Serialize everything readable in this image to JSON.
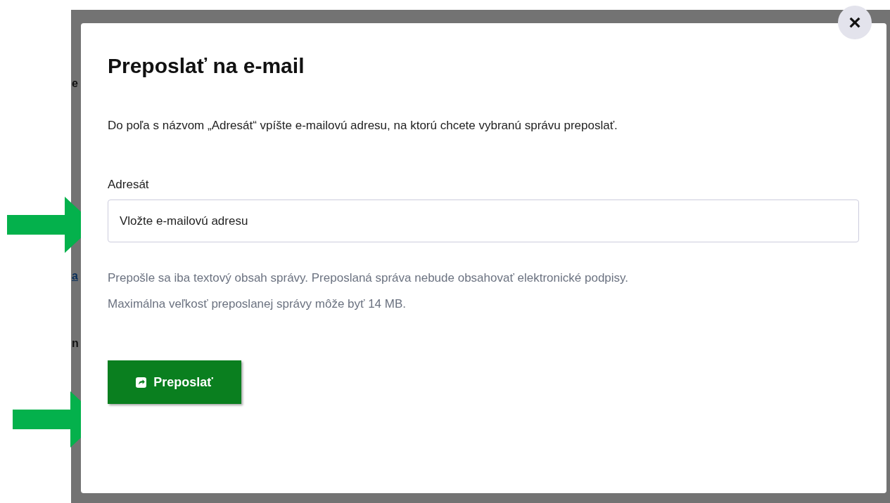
{
  "background_fragments": [
    {
      "text": "e",
      "kind": "text"
    },
    {
      "text": "a",
      "kind": "link"
    },
    {
      "text": "n",
      "kind": "text"
    }
  ],
  "dialog": {
    "title": "Preposlať na e-mail",
    "close_label": "×",
    "description": "Do poľa s názvom „Adresát“ vpíšte e-mailovú adresu, na ktorú chcete vybranú správu preposlať.",
    "field": {
      "label": "Adresát",
      "placeholder": "Vložte e-mailovú adresu"
    },
    "notes": [
      "Prepošle sa iba textový obsah správy. Preposlaná správa nebude obsahovať elektronické podpisy.",
      "Maximálna veľkosť preposlanej správy môže byť 14 MB."
    ],
    "submit_label": "Preposlať"
  }
}
